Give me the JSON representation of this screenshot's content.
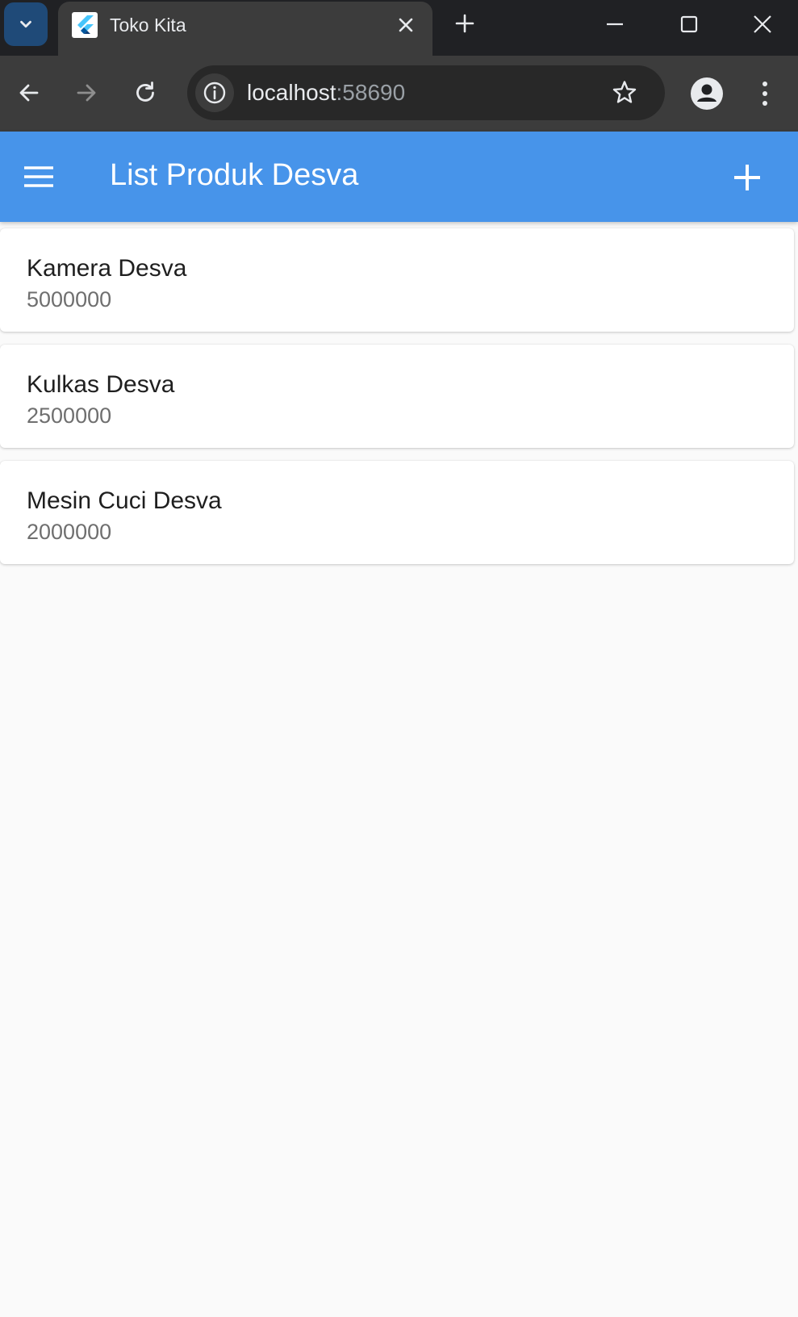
{
  "browser": {
    "tab": {
      "title": "Toko Kita",
      "favicon": "flutter-icon"
    },
    "address_bar": {
      "host": "localhost",
      "port": ":58690"
    },
    "icons": {
      "tab_search": "chevron-down-icon",
      "close_tab": "close-icon",
      "new_tab": "plus-icon",
      "minimize": "minimize-icon",
      "maximize": "maximize-icon",
      "close_window": "close-icon",
      "back": "arrow-left-icon",
      "forward": "arrow-right-icon",
      "reload": "reload-icon",
      "site_info": "info-icon",
      "bookmark": "star-icon",
      "profile": "account-icon",
      "menu": "more-vert-icon"
    }
  },
  "appbar": {
    "title": "List Produk Desva",
    "menu_icon": "hamburger-icon",
    "action_icon": "add-icon",
    "color": "#4794ea"
  },
  "products": [
    {
      "name": "Kamera Desva",
      "price": "5000000"
    },
    {
      "name": "Kulkas Desva",
      "price": "2500000"
    },
    {
      "name": "Mesin Cuci Desva",
      "price": "2000000"
    }
  ]
}
